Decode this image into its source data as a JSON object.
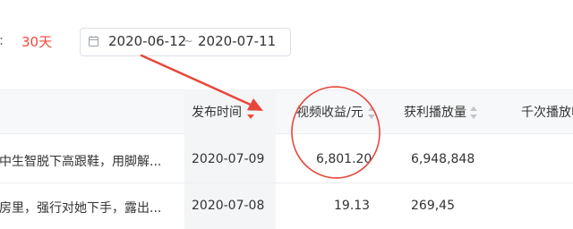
{
  "filter": {
    "colon": ":",
    "days_label": "30天",
    "date_start": "2020-06-12",
    "date_separator": "~",
    "date_end": "2020-07-11",
    "icon": "calendar-icon"
  },
  "table": {
    "headers": {
      "publish_time": "发布时间",
      "video_revenue": "视频收益/元",
      "profitable_plays": "获利播放量",
      "cpm": "千次播放收"
    },
    "rows": [
      {
        "title": "中生智脱下高跟鞋，用脚解...",
        "publish_time": "2020-07-09",
        "video_revenue": "6,801.20",
        "profitable_plays": "6,948,848"
      },
      {
        "title": "房里，强行对她下手，露出...",
        "publish_time": "2020-07-08",
        "video_revenue": "19.13",
        "profitable_plays": "269,45"
      }
    ]
  },
  "colors": {
    "accent_red": "#f24a3d",
    "annotation_red": "#e8463a",
    "header_bg": "#f7f8fa"
  },
  "icons": {
    "sort": "sort-arrows-icon",
    "calendar": "calendar-icon"
  }
}
